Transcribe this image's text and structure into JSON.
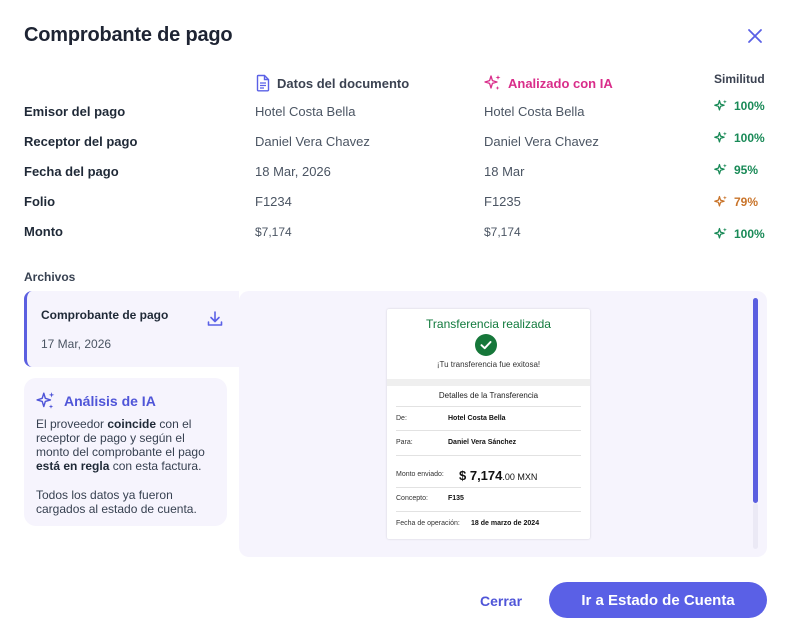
{
  "dialog": {
    "title": "Comprobante de pago"
  },
  "columns": {
    "document": "Datos del documento",
    "ai": "Analizado con IA",
    "similarity": "Similitud"
  },
  "rows": [
    {
      "label": "Emisor del pago",
      "doc": "Hotel Costa Bella",
      "ai": "Hotel Costa Bella",
      "similarity": "100%",
      "status": "good"
    },
    {
      "label": "Receptor del pago",
      "doc": "Daniel Vera Chavez",
      "ai": "Daniel Vera Chavez",
      "similarity": "100%",
      "status": "good"
    },
    {
      "label": "Fecha del pago",
      "doc": "18 Mar, 2026",
      "ai": "18 Mar",
      "similarity": "95%",
      "status": "good"
    },
    {
      "label": "Folio",
      "doc": "F1234",
      "ai": "F1235",
      "similarity": "79%",
      "status": "warn"
    },
    {
      "label": "Monto",
      "doc": "$7,174",
      "ai": "$7,174",
      "similarity": "100%",
      "status": "good"
    }
  ],
  "files": {
    "label": "Archivos",
    "item": {
      "name": "Comprobante de pago",
      "date": "17 Mar, 2026"
    }
  },
  "analysis": {
    "title": "Análisis de IA",
    "p1_a": "El proveedor ",
    "p1_b": "coincide",
    "p1_c": " con el receptor de pago y según el monto del comprobante el pago ",
    "p1_d": "está en regla",
    "p1_e": " con esta factura.",
    "p2": "Todos los datos ya fueron cargados al estado de cuenta."
  },
  "receipt": {
    "title": "Transferencia realizada",
    "subtitle": "¡Tu transferencia fue exitosa!",
    "section": "Detalles de la Transferencia",
    "de_label": "De:",
    "de_value": "Hotel Costa Bella",
    "para_label": "Para:",
    "para_value": "Daniel Vera Sánchez",
    "monto_label": "Monto enviado:",
    "monto_main": "$ 7,174",
    "monto_dec": ".00 MXN",
    "concepto_label": "Concepto:",
    "concepto_value": "F135",
    "fecha_label": "Fecha de operación:",
    "fecha_value": "18 de marzo de 2024"
  },
  "actions": {
    "cancel": "Cerrar",
    "primary": "Ir a Estado de Cuenta"
  },
  "colors": {
    "accent": "#5a60e6",
    "ai_pink": "#d92d8a",
    "good": "#198a57",
    "warn": "#c9742a"
  },
  "icons": {
    "close": "close-icon",
    "document": "document-icon",
    "sparkle": "sparkle-icon",
    "download": "download-icon",
    "check": "check-icon"
  }
}
